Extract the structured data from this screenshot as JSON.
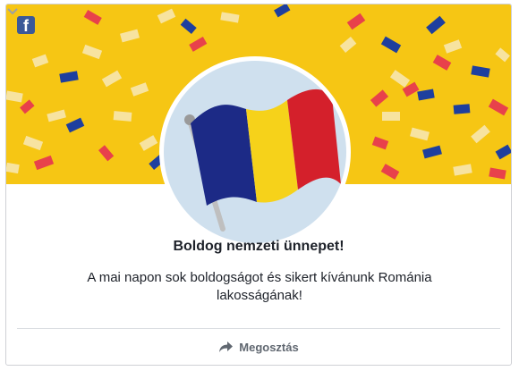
{
  "app": {
    "logo_glyph": "f",
    "logo_icon": "facebook-logo-icon",
    "menu_icon": "chevron-down-icon"
  },
  "post": {
    "title": "Boldog nemzeti ünnepet!",
    "message": "A mai napon sok boldogságot és sikert kívánunk Románia lakosságának!",
    "image_description_icon": "romania-flag-icon"
  },
  "actions": {
    "share_label": "Megosztás",
    "share_icon": "share-arrow-icon"
  },
  "colors": {
    "banner_yellow": "#f6c614",
    "flag_blue": "#1c2a86",
    "flag_yellow": "#f6d21a",
    "flag_red": "#d4202b",
    "brand": "#3b5998"
  }
}
